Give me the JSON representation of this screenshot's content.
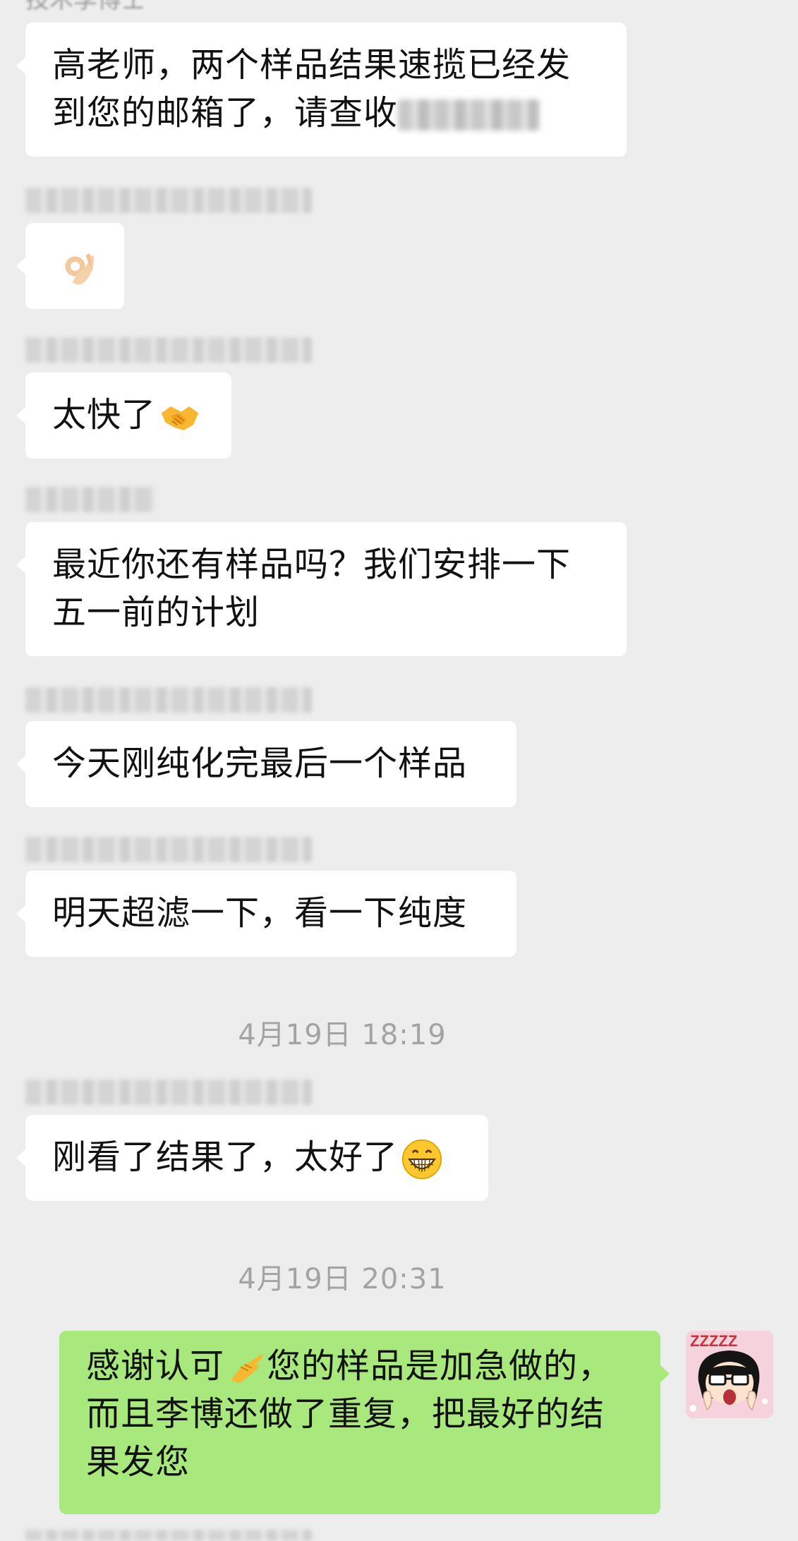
{
  "header": {
    "sender_label": "技术李博士"
  },
  "messages": [
    {
      "id": "m1",
      "side": "left",
      "text": "高老师，两个样品结果速揽已经发到您的邮箱了，请查收"
    },
    {
      "id": "m2",
      "side": "left",
      "emoji": "ok-hand-emoji"
    },
    {
      "id": "m3",
      "side": "left",
      "text": "太快了",
      "emoji": "handshake-emoji"
    },
    {
      "id": "m4",
      "side": "left",
      "text": "最近你还有样品吗？我们安排一下五一前的计划"
    },
    {
      "id": "m5",
      "side": "left",
      "text": "今天刚纯化完最后一个样品"
    },
    {
      "id": "m6",
      "side": "left",
      "text": "明天超滤一下，看一下纯度"
    },
    {
      "id": "m7",
      "side": "left",
      "text": "刚看了结果了，太好了",
      "emoji": "grinning-face-emoji"
    },
    {
      "id": "m8",
      "side": "right",
      "text_before": "感谢认可",
      "emoji": "raised-hand-emoji",
      "text_after": "您的样品是加急做的，而且李博还做了重复，把最好的结果发您"
    }
  ],
  "timestamps": [
    "4月19日 18:19",
    "4月19日 20:31"
  ],
  "avatar": {
    "icon": "cartoon-girl-avatar",
    "label": "ZZZZZ"
  },
  "colors": {
    "background": "#ededed",
    "bubble_left": "#ffffff",
    "bubble_right": "#a8e87c",
    "timestamp": "#a3a3a3"
  }
}
